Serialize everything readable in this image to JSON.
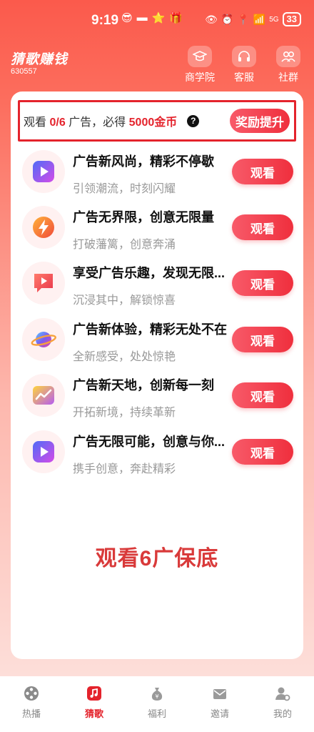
{
  "status_bar": {
    "time": "9:19",
    "battery": "33",
    "signal_label": "5G"
  },
  "header": {
    "app_title": "猜歌赚钱",
    "user_id": "630557",
    "nav": [
      {
        "label": "商学院",
        "icon": "graduation-cap-icon"
      },
      {
        "label": "客服",
        "icon": "headset-icon"
      },
      {
        "label": "社群",
        "icon": "community-icon"
      }
    ]
  },
  "reward": {
    "prefix": "观看",
    "progress": "0/6",
    "middle": "广告，必得",
    "amount": "5000金币",
    "help_glyph": "?",
    "button_label": "奖励提升"
  },
  "ads": [
    {
      "title": "广告新风尚，精彩不停歇",
      "subtitle": "引领潮流，时刻闪耀",
      "icon": "play-video-icon",
      "button": "观看"
    },
    {
      "title": "广告无界限，创意无限量",
      "subtitle": "打破藩篱，创意奔涌",
      "icon": "lightning-icon",
      "button": "观看"
    },
    {
      "title": "享受广告乐趣，发现无限...",
      "subtitle": "沉浸其中，解锁惊喜",
      "icon": "video-chat-icon",
      "button": "观看"
    },
    {
      "title": "广告新体验，精彩无处不在",
      "subtitle": "全新感受，处处惊艳",
      "icon": "planet-icon",
      "button": "观看"
    },
    {
      "title": "广告新天地，创新每一刻",
      "subtitle": "开拓新境，持续革新",
      "icon": "trend-chart-icon",
      "button": "观看"
    },
    {
      "title": "广告无限可能，创意与你...",
      "subtitle": "携手创意，奔赴精彩",
      "icon": "play-video-icon",
      "button": "观看"
    }
  ],
  "guarantee_text": "观看6广保底",
  "tabs": [
    {
      "label": "热播",
      "icon": "film-reel-icon",
      "active": false
    },
    {
      "label": "猜歌",
      "icon": "music-note-icon",
      "active": true
    },
    {
      "label": "福利",
      "icon": "money-bag-icon",
      "active": false
    },
    {
      "label": "邀请",
      "icon": "envelope-icon",
      "active": false
    },
    {
      "label": "我的",
      "icon": "user-settings-icon",
      "active": false
    }
  ],
  "colors": {
    "accent": "#e4232c",
    "button_start": "#f85a69",
    "button_end": "#ef2f3d",
    "header_bg": "#fb5a4c"
  }
}
